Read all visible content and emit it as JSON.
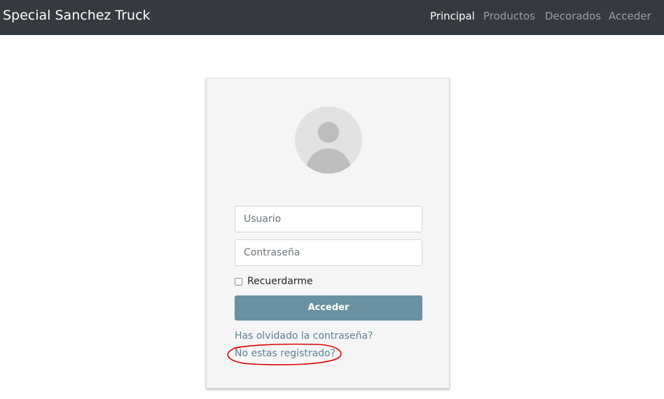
{
  "navbar": {
    "brand": "Special Sanchez Truck",
    "links": [
      {
        "label": "Principal",
        "active": true
      },
      {
        "label": "Productos",
        "active": false
      },
      {
        "label": "Decorados",
        "active": false
      },
      {
        "label": "Acceder",
        "active": false
      }
    ]
  },
  "login": {
    "username_placeholder": "Usuario",
    "password_placeholder": "Contraseña",
    "remember_label": "Recuerdarme",
    "remember_checked": false,
    "submit_label": "Acceder",
    "forgot_password_link": "Has olvidado la contraseña?",
    "register_link": "No estas registrado?"
  },
  "colors": {
    "navbar_bg": "#343a40",
    "card_bg": "#f5f5f5",
    "button_bg": "#6993a2",
    "link": "#5b8394",
    "annotation": "#e00000"
  },
  "icons": {
    "avatar": "user-avatar-placeholder-icon"
  }
}
